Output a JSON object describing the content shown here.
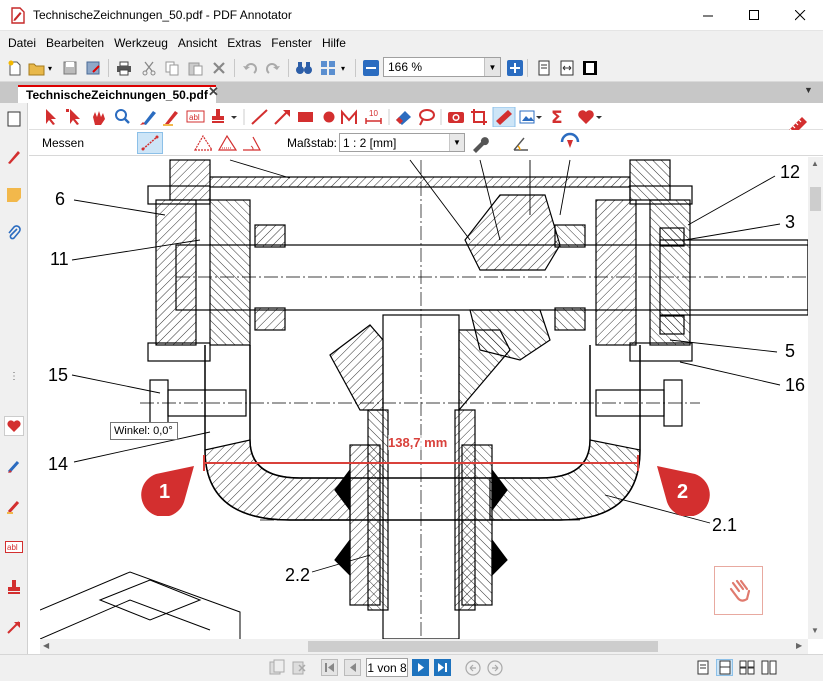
{
  "window": {
    "title": "TechnischeZeichnungen_50.pdf - PDF Annotator",
    "minimize_icon": "minimize-icon",
    "maximize_icon": "maximize-icon",
    "close_icon": "close-icon"
  },
  "menu": [
    {
      "label": "Datei"
    },
    {
      "label": "Bearbeiten"
    },
    {
      "label": "Werkzeug"
    },
    {
      "label": "Ansicht"
    },
    {
      "label": "Extras"
    },
    {
      "label": "Fenster"
    },
    {
      "label": "Hilfe"
    }
  ],
  "toolbar": {
    "zoom_value": "166 %"
  },
  "tab": {
    "label": "TechnischeZeichnungen_50.pdf",
    "close": "✕",
    "dropdown": "▼"
  },
  "measure_bar": {
    "label": "Messen",
    "scale_label": "Maßstab:",
    "scale_value": "1 : 2 [mm]"
  },
  "drawing": {
    "labels": {
      "n6": "6",
      "n11": "11",
      "n15": "15",
      "n14": "14",
      "n12": "12",
      "n3": "3",
      "n5": "5",
      "n16": "16",
      "n2_1": "2.1",
      "n2_2": "2.2"
    },
    "measurement": "138,7 mm",
    "tooltip": "Winkel: 0,0°",
    "pin_left": "1",
    "pin_right": "2"
  },
  "status": {
    "page_indicator": "1 von 8"
  },
  "colors": {
    "accent_red": "#d32f2f",
    "measure_red": "#d9413b",
    "nav_blue": "#1e73be",
    "chrome_gray": "#f0f0f0"
  }
}
